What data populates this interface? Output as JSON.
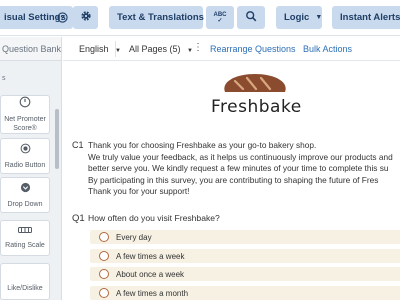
{
  "topbar": {
    "visual_settings": "isual Settings",
    "text_translations": "Text & Translations",
    "logic": "Logic",
    "instant_alerts": "Instant Alerts",
    "spellcheck_label": "ABC"
  },
  "left_panel": {
    "header": "Question Bank",
    "category": "s",
    "tiles": [
      {
        "label": "Net Promoter Score®",
        "icon": "nps-icon"
      },
      {
        "label": "Radio Button",
        "icon": "radio-icon"
      },
      {
        "label": "Drop Down",
        "icon": "dropdown-icon"
      },
      {
        "label": "Rating Scale",
        "icon": "rating-scale-icon"
      },
      {
        "label": "Like/Dislike",
        "icon": "like-dislike-icon"
      }
    ]
  },
  "toolbar2": {
    "language": "English",
    "pages": "All Pages (5)",
    "rearrange": "Rearrange Questions",
    "bulk_actions": "Bulk Actions"
  },
  "survey": {
    "brand": "Freshbake",
    "c1": {
      "number": "C1",
      "lines": [
        "Thank you for choosing Freshbake as your go-to bakery shop.",
        "We truly value your feedback, as it helps us continuously improve our products and",
        "better serve you.  We kindly request a few minutes of your time to complete this su",
        "By participating in this survey, you are contributing to shaping the future of Fres",
        "Thank you for your support!"
      ]
    },
    "q1": {
      "number": "Q1",
      "question": "How often do you visit Freshbake?",
      "options": [
        "Every day",
        "A few times a week",
        "About once a week",
        "A few times a month"
      ]
    }
  },
  "colors": {
    "accent": "#2d6fb7",
    "button_bg": "#c9d9ee",
    "radio": "#b06a3f",
    "option_bg": "#f7f1e4",
    "loaf": "#8a4b2e"
  }
}
